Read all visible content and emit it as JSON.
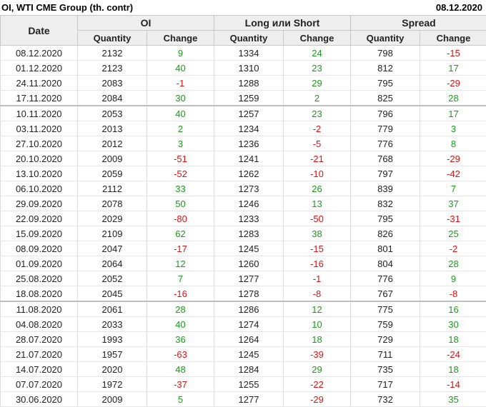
{
  "header": {
    "title": "OI, WTI CME Group (th. contr)",
    "date": "08.12.2020"
  },
  "columns": {
    "date": "Date",
    "groups": [
      "OI",
      "Long или Short",
      "Spread"
    ],
    "sub": [
      "Quantity",
      "Change",
      "Quantity",
      "Change",
      "Quantity",
      "Change"
    ]
  },
  "rows": [
    {
      "date": "08.12.2020",
      "oi_q": "2132",
      "oi_c": "9",
      "ls_q": "1334",
      "ls_c": "24",
      "sp_q": "798",
      "sp_c": "-15"
    },
    {
      "date": "01.12.2020",
      "oi_q": "2123",
      "oi_c": "40",
      "ls_q": "1310",
      "ls_c": "23",
      "sp_q": "812",
      "sp_c": "17"
    },
    {
      "date": "24.11.2020",
      "oi_q": "2083",
      "oi_c": "-1",
      "ls_q": "1288",
      "ls_c": "29",
      "sp_q": "795",
      "sp_c": "-29"
    },
    {
      "date": "17.11.2020",
      "oi_q": "2084",
      "oi_c": "30",
      "ls_q": "1259",
      "ls_c": "2",
      "sp_q": "825",
      "sp_c": "28"
    },
    {
      "date": "10.11.2020",
      "oi_q": "2053",
      "oi_c": "40",
      "ls_q": "1257",
      "ls_c": "23",
      "sp_q": "796",
      "sp_c": "17"
    },
    {
      "date": "03.11.2020",
      "oi_q": "2013",
      "oi_c": "2",
      "ls_q": "1234",
      "ls_c": "-2",
      "sp_q": "779",
      "sp_c": "3"
    },
    {
      "date": "27.10.2020",
      "oi_q": "2012",
      "oi_c": "3",
      "ls_q": "1236",
      "ls_c": "-5",
      "sp_q": "776",
      "sp_c": "8"
    },
    {
      "date": "20.10.2020",
      "oi_q": "2009",
      "oi_c": "-51",
      "ls_q": "1241",
      "ls_c": "-21",
      "sp_q": "768",
      "sp_c": "-29"
    },
    {
      "date": "13.10.2020",
      "oi_q": "2059",
      "oi_c": "-52",
      "ls_q": "1262",
      "ls_c": "-10",
      "sp_q": "797",
      "sp_c": "-42"
    },
    {
      "date": "06.10.2020",
      "oi_q": "2112",
      "oi_c": "33",
      "ls_q": "1273",
      "ls_c": "26",
      "sp_q": "839",
      "sp_c": "7"
    },
    {
      "date": "29.09.2020",
      "oi_q": "2078",
      "oi_c": "50",
      "ls_q": "1246",
      "ls_c": "13",
      "sp_q": "832",
      "sp_c": "37"
    },
    {
      "date": "22.09.2020",
      "oi_q": "2029",
      "oi_c": "-80",
      "ls_q": "1233",
      "ls_c": "-50",
      "sp_q": "795",
      "sp_c": "-31"
    },
    {
      "date": "15.09.2020",
      "oi_q": "2109",
      "oi_c": "62",
      "ls_q": "1283",
      "ls_c": "38",
      "sp_q": "826",
      "sp_c": "25"
    },
    {
      "date": "08.09.2020",
      "oi_q": "2047",
      "oi_c": "-17",
      "ls_q": "1245",
      "ls_c": "-15",
      "sp_q": "801",
      "sp_c": "-2"
    },
    {
      "date": "01.09.2020",
      "oi_q": "2064",
      "oi_c": "12",
      "ls_q": "1260",
      "ls_c": "-16",
      "sp_q": "804",
      "sp_c": "28"
    },
    {
      "date": "25.08.2020",
      "oi_q": "2052",
      "oi_c": "7",
      "ls_q": "1277",
      "ls_c": "-1",
      "sp_q": "776",
      "sp_c": "9"
    },
    {
      "date": "18.08.2020",
      "oi_q": "2045",
      "oi_c": "-16",
      "ls_q": "1278",
      "ls_c": "-8",
      "sp_q": "767",
      "sp_c": "-8"
    },
    {
      "date": "11.08.2020",
      "oi_q": "2061",
      "oi_c": "28",
      "ls_q": "1286",
      "ls_c": "12",
      "sp_q": "775",
      "sp_c": "16"
    },
    {
      "date": "04.08.2020",
      "oi_q": "2033",
      "oi_c": "40",
      "ls_q": "1274",
      "ls_c": "10",
      "sp_q": "759",
      "sp_c": "30"
    },
    {
      "date": "28.07.2020",
      "oi_q": "1993",
      "oi_c": "36",
      "ls_q": "1264",
      "ls_c": "18",
      "sp_q": "729",
      "sp_c": "18"
    },
    {
      "date": "21.07.2020",
      "oi_q": "1957",
      "oi_c": "-63",
      "ls_q": "1245",
      "ls_c": "-39",
      "sp_q": "711",
      "sp_c": "-24"
    },
    {
      "date": "14.07.2020",
      "oi_q": "2020",
      "oi_c": "48",
      "ls_q": "1284",
      "ls_c": "29",
      "sp_q": "735",
      "sp_c": "18"
    },
    {
      "date": "07.07.2020",
      "oi_q": "1972",
      "oi_c": "-37",
      "ls_q": "1255",
      "ls_c": "-22",
      "sp_q": "717",
      "sp_c": "-14"
    },
    {
      "date": "30.06.2020",
      "oi_q": "2009",
      "oi_c": "5",
      "ls_q": "1277",
      "ls_c": "-29",
      "sp_q": "732",
      "sp_c": "35"
    }
  ],
  "colors": {
    "positive": "#1a9a1a",
    "negative": "#e01010",
    "header_bg": "#eeeeee"
  }
}
